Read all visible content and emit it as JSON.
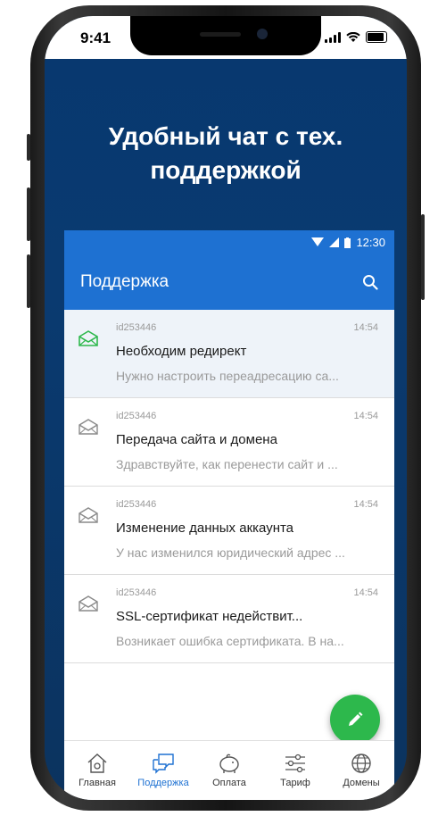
{
  "ios_status": {
    "time": "9:41"
  },
  "headline": {
    "line1": "Удобный чат с тех.",
    "line2": "поддержкой"
  },
  "android_status": {
    "time": "12:30"
  },
  "appbar": {
    "title": "Поддержка"
  },
  "tickets": [
    {
      "id": "id253446",
      "time": "14:54",
      "title": "Необходим редирект",
      "preview": "Нужно настроить переадресацию са...",
      "active": true
    },
    {
      "id": "id253446",
      "time": "14:54",
      "title": "Передача сайта и домена",
      "preview": "Здравствуйте, как перенести сайт и ...",
      "active": false
    },
    {
      "id": "id253446",
      "time": "14:54",
      "title": "Изменение данных аккаунта",
      "preview": "У нас изменился юридический адрес ...",
      "active": false
    },
    {
      "id": "id253446",
      "time": "14:54",
      "title": "SSL-сертификат недействит...",
      "preview": "Возникает ошибка сертификата. В на...",
      "active": false
    }
  ],
  "bottom_nav": [
    {
      "label": "Главная",
      "icon": "home-icon"
    },
    {
      "label": "Поддержка",
      "icon": "chat-icon",
      "active": true
    },
    {
      "label": "Оплата",
      "icon": "piggy-bank-icon"
    },
    {
      "label": "Тариф",
      "icon": "sliders-icon"
    },
    {
      "label": "Домены",
      "icon": "globe-icon"
    }
  ],
  "colors": {
    "primary": "#1e71d2",
    "fab": "#2db84c",
    "background": "#0a3a70",
    "active_icon": "#2db84c"
  }
}
